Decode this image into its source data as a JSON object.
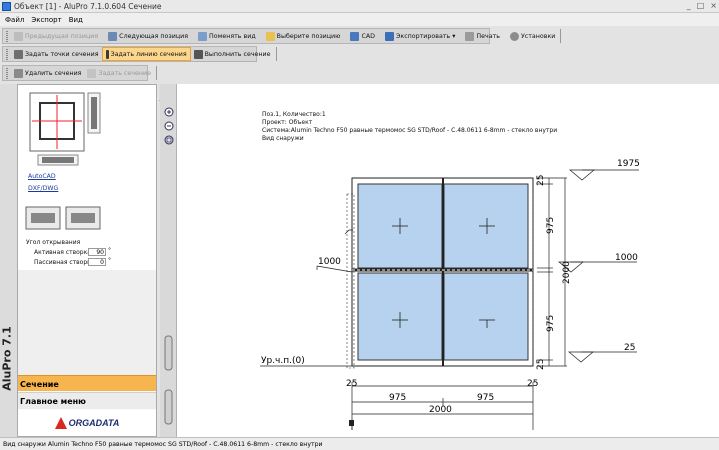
{
  "window": {
    "title": "Объект [1] - AluPro 7.1.0.604 Сечение",
    "controls": [
      "_",
      "□",
      "×"
    ]
  },
  "menu": [
    "Файл",
    "Экспорт",
    "Вид"
  ],
  "toolbar1": [
    {
      "label": "Предыдущая позиция",
      "icon": "arrow-left-icon",
      "enabled": false
    },
    {
      "label": "Следующая позиция",
      "icon": "arrow-right-icon",
      "enabled": true
    },
    {
      "label": "Поменять вид",
      "icon": "swap-view-icon",
      "enabled": true
    },
    {
      "label": "Выберите позицию",
      "icon": "folder-icon",
      "enabled": true
    },
    {
      "label": "CAD",
      "icon": "cad-icon",
      "enabled": true
    },
    {
      "label": "Экспортировать",
      "icon": "export-icon",
      "enabled": true
    },
    {
      "label": "Печать",
      "icon": "printer-icon",
      "enabled": true
    },
    {
      "label": "Установки",
      "icon": "gear-icon",
      "enabled": true
    }
  ],
  "toolbar2": [
    {
      "label": "Задать точки сечения",
      "icon": "points-icon",
      "active": false
    },
    {
      "label": "Задать линию сечения",
      "icon": "line-icon",
      "active": true
    },
    {
      "label": "Выполнить сечение",
      "icon": "execute-icon",
      "active": false
    }
  ],
  "toolbar3": [
    {
      "label": "Удалить сечения",
      "icon": "delete-icon",
      "enabled": true
    },
    {
      "label": "Задать сечение",
      "icon": "play-icon",
      "enabled": false
    }
  ],
  "left_panel": {
    "links": [
      "AutoCAD",
      "DXF/DWG"
    ],
    "opening_angle_label": "Угол открывания",
    "active_sash_label": "Активная створка",
    "active_sash_value": "90",
    "passive_sash_label": "Пассивная створк",
    "passive_sash_value": "0",
    "degree_symbol": "°",
    "nav_active": "Сечение",
    "nav_main": "Главное меню",
    "logo_text": "ORGADATA",
    "vertical_label": "AluPro 7.1"
  },
  "drawing": {
    "info_lines": [
      "Поз.1, Количество:1",
      "Проект: Объект",
      "Система:Alumin Techno F50 равные термомос SG STD/Roof - C.48.0611 6-8mm - стекло внутри",
      "Вид снаружи"
    ],
    "dim_top": "1975",
    "dim_mid_right": "1000",
    "dim_bottom_right": "25",
    "dim_left": "1000",
    "vert_dims": [
      "25",
      "975",
      "2000",
      "975",
      "25"
    ],
    "horiz_small": [
      "25",
      "25"
    ],
    "horiz_mid": [
      "975",
      "975"
    ],
    "horiz_total": "2000",
    "floor_label": "Ур.ч.п.(0)"
  },
  "status_bar": "Вид снаружи    Alumin Techno F50 равные термомос SG STD/Roof - C.48.0611 6-8mm - стекло внутри",
  "colors": {
    "active_orange": "#f7b54f",
    "glass_blue": "#bcd6ef",
    "logo_red": "#d9281f",
    "logo_blue": "#1d2c72"
  }
}
